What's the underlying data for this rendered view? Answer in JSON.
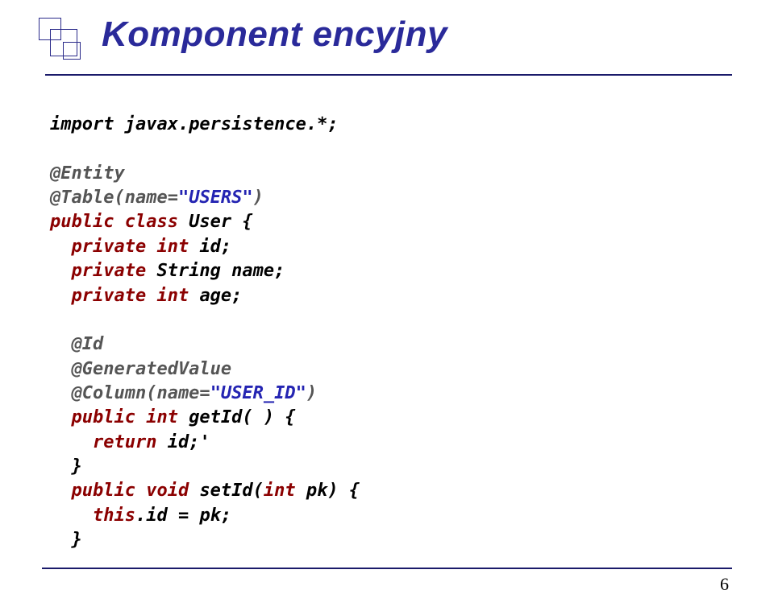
{
  "title": "Komponent encyjny",
  "page_number": "6",
  "code": {
    "l1_a": "import ",
    "l1_b": "javax.persistence.*;",
    "l3": "@Entity",
    "l4_a": "@Table(name=",
    "l4_b": "\"USERS\"",
    "l4_c": ")",
    "l5_a": "public class ",
    "l5_b": "User {",
    "l6_a": "  private int ",
    "l6_b": "id;",
    "l7_a": "  private ",
    "l7_b": "String name;",
    "l8_a": "  private int ",
    "l8_b": "age;",
    "l10": "  @Id",
    "l11": "  @GeneratedValue",
    "l12_a": "  @Column(name=",
    "l12_b": "\"USER_ID\"",
    "l12_c": ")",
    "l13_a": "  public int ",
    "l13_b": "getId( ) {",
    "l14_a": "    return ",
    "l14_b": "id;'",
    "l15": "  }",
    "l16_a": "  public void ",
    "l16_b": "setId(",
    "l16_c": "int ",
    "l16_d": "pk) {",
    "l17_a": "    this",
    "l17_b": ".id = pk;",
    "l18": "  }"
  }
}
